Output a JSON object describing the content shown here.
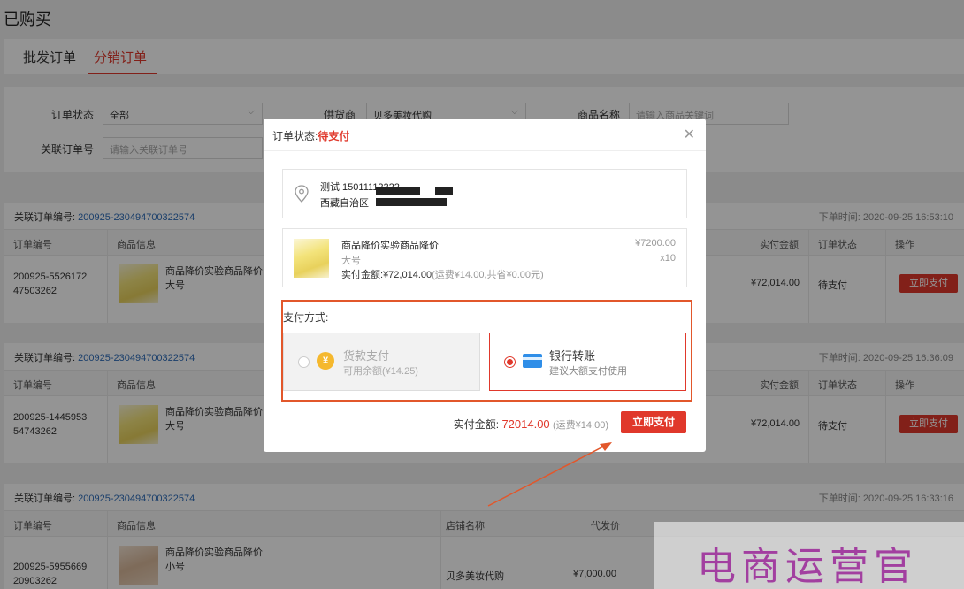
{
  "page": {
    "title": "已购买"
  },
  "tabs": [
    {
      "label": "批发订单"
    },
    {
      "label": "分销订单"
    }
  ],
  "filters": {
    "order_status": {
      "label": "订单状态",
      "value": "全部"
    },
    "supplier": {
      "label": "供货商",
      "value": "贝多美妆代购"
    },
    "product_name": {
      "label": "商品名称",
      "placeholder": "请输入商品关键词"
    },
    "related_order": {
      "label": "关联订单号",
      "placeholder": "请输入关联订单号"
    }
  },
  "columns": {
    "order_no": "订单编号",
    "product_info": "商品信息",
    "shop_name": "店铺名称",
    "agent_price": "代发价",
    "paid_amount": "实付金额",
    "order_status": "订单状态",
    "actions": "操作"
  },
  "orders": [
    {
      "related_label": "关联订单编号:",
      "related_no": "200925-230494700322574",
      "time": "下单时间: 2020-09-25 16:53:10",
      "order_no_a": "200925-5526172",
      "order_no_b": "47503262",
      "product_name": "商品降价实验商品降价",
      "spec": "大号",
      "paid": "¥72,014.00",
      "status": "待支付",
      "pay_label": "立即支付"
    },
    {
      "related_label": "关联订单编号:",
      "related_no": "200925-230494700322574",
      "time": "下单时间: 2020-09-25 16:36:09",
      "order_no_a": "200925-1445953",
      "order_no_b": "54743262",
      "product_name": "商品降价实验商品降价",
      "spec": "大号",
      "paid": "¥72,014.00",
      "status": "待支付",
      "pay_label": "立即支付"
    },
    {
      "related_label": "关联订单编号:",
      "related_no": "200925-230494700322574",
      "time": "下单时间: 2020-09-25 16:33:16",
      "order_no_a": "200925-5955669",
      "order_no_b": "20903262",
      "product_name": "商品降价实验商品降价",
      "spec": "小号",
      "shop": "贝多美妆代购",
      "agent_price": "¥7,000.00"
    }
  ],
  "modal": {
    "title_label": "订单状态:",
    "title_status": "待支付",
    "address": {
      "name_phone": "测试 15011112222",
      "line": "西藏自治区"
    },
    "product": {
      "name": "商品降价实验商品降价",
      "spec": "大号",
      "sum_label": "实付金额:",
      "sum_value": "¥72,014.00",
      "sum_note": "(运费¥14.00,共省¥0.00元)",
      "price": "¥7200.00",
      "qty": "x10"
    },
    "pay_method_label": "支付方式:",
    "options": [
      {
        "title": "货款支付",
        "sub": "可用余额(¥14.25)",
        "icon": "¥"
      },
      {
        "title": "银行转账",
        "sub": "建议大额支付使用"
      }
    ],
    "total_label": "实付金额:",
    "total_value": "72014.00",
    "total_note": "(运费¥14.00)",
    "pay_button": "立即支付"
  },
  "watermark": {
    "text": "电商运营官"
  },
  "colors": {
    "accent": "#e0382b",
    "link": "#2d6cb8",
    "highlight": "#e2572b",
    "card": "#2f8ee8",
    "coin": "#f5b82e"
  }
}
